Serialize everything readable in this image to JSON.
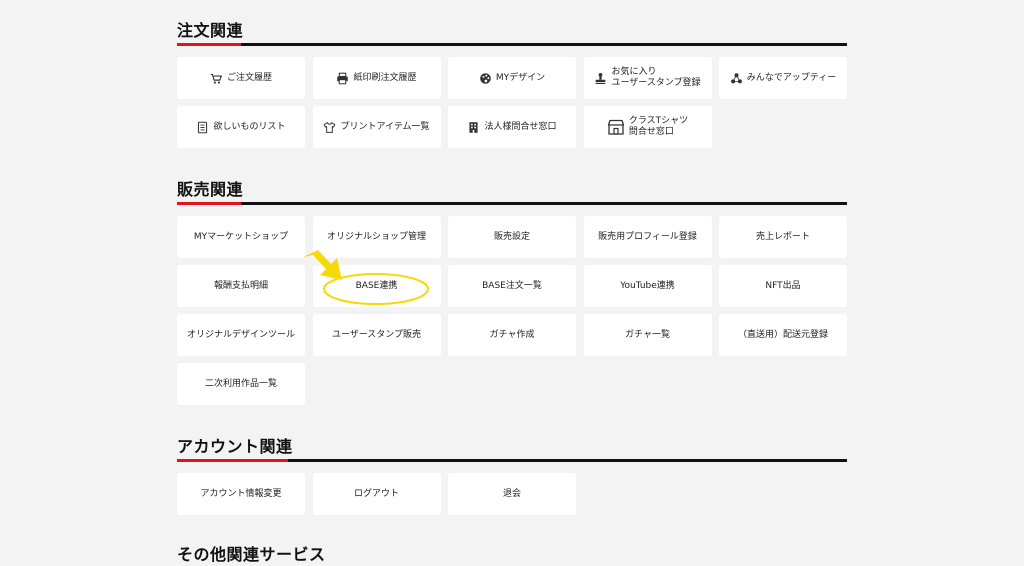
{
  "sections": [
    {
      "title": "注文関連",
      "items": [
        {
          "label": "ご注文履歴",
          "icon": "cart-icon"
        },
        {
          "label": "紙印刷注文履歴",
          "icon": "printer-icon"
        },
        {
          "label": "MYデザイン",
          "icon": "palette-icon"
        },
        {
          "label": "お気に入り\nユーザースタンプ登録",
          "icon": "stamp-icon"
        },
        {
          "label": "みんなでアップティー",
          "icon": "group-icon"
        },
        {
          "label": "欲しいものリスト",
          "icon": "list-icon"
        },
        {
          "label": "プリントアイテム一覧",
          "icon": "tshirt-icon"
        },
        {
          "label": "法人様問合せ窓口",
          "icon": "building-icon"
        },
        {
          "label": "クラスTシャツ\n問合せ窓口",
          "icon": "shop-icon"
        }
      ]
    },
    {
      "title": "販売関連",
      "items": [
        {
          "label": "MYマーケットショップ"
        },
        {
          "label": "オリジナルショップ管理"
        },
        {
          "label": "販売設定"
        },
        {
          "label": "販売用プロフィール登録"
        },
        {
          "label": "売上レポート"
        },
        {
          "label": "報酬支払明細"
        },
        {
          "label": "BASE連携"
        },
        {
          "label": "BASE注文一覧"
        },
        {
          "label": "YouTube連携"
        },
        {
          "label": "NFT出品"
        },
        {
          "label": "オリジナルデザインツール"
        },
        {
          "label": "ユーザースタンプ販売"
        },
        {
          "label": "ガチャ作成"
        },
        {
          "label": "ガチャ一覧"
        },
        {
          "label": "（直送用）配送元登録"
        },
        {
          "label": "二次利用作品一覧"
        }
      ]
    },
    {
      "title": "アカウント関連",
      "items": [
        {
          "label": "アカウント情報変更"
        },
        {
          "label": "ログアウト"
        },
        {
          "label": "退会"
        }
      ]
    },
    {
      "title": "その他関連サービス",
      "items": []
    }
  ],
  "annotation": {
    "color": "#f5d90a",
    "target": "BASE連携"
  },
  "colors": {
    "accent": "#e0141e",
    "rule": "#111111",
    "background": "#f3f3f3",
    "card": "#ffffff"
  }
}
